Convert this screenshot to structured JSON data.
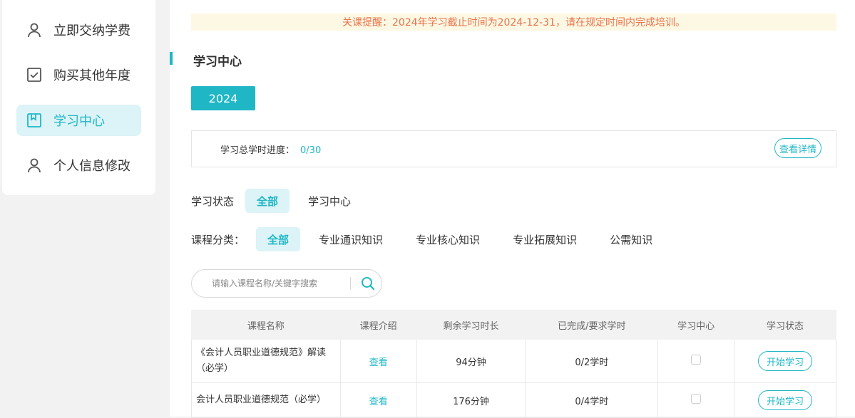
{
  "sidebar": {
    "items": [
      {
        "label": "立即交纳学费",
        "icon": "user-icon"
      },
      {
        "label": "购买其他年度",
        "icon": "checkbox-icon"
      },
      {
        "label": "学习中心",
        "icon": "bookmark-icon",
        "active": true
      },
      {
        "label": "个人信息修改",
        "icon": "user-icon"
      }
    ]
  },
  "notice": "关课提醒：2024年学习截止时间为2024-12-31，请在规定时间内完成培训。",
  "page_title": "学习中心",
  "year_tab": "2024",
  "progress": {
    "label": "学习总学时进度：",
    "value": "0/30",
    "detail_button": "查看详情"
  },
  "status_filter": {
    "label": "学习状态",
    "options": [
      "全部",
      "学习中心"
    ],
    "selected": "全部"
  },
  "category_filter": {
    "label": "课程分类：",
    "options": [
      "全部",
      "专业通识知识",
      "专业核心知识",
      "专业拓展知识",
      "公需知识"
    ],
    "selected": "全部"
  },
  "search": {
    "placeholder": "请输入课程名称/关键字搜索"
  },
  "table": {
    "headers": [
      "课程名称",
      "课程介绍",
      "剩余学习时长",
      "已完成/要求学时",
      "学习中心",
      "学习状态"
    ],
    "rows": [
      {
        "name": "《会计人员职业道德规范》解读（必学）",
        "intro": "查看",
        "remaining": "94分钟",
        "progress": "0/2学时",
        "status": "开始学习"
      },
      {
        "name": "会计人员职业道德规范（必学）",
        "intro": "查看",
        "remaining": "176分钟",
        "progress": "0/4学时",
        "status": "开始学习"
      }
    ]
  },
  "colors": {
    "accent": "#1fb7c6",
    "notice_text": "#e8734a",
    "notice_bg": "#fdf8e4",
    "active_bg": "#dcf3f7"
  }
}
